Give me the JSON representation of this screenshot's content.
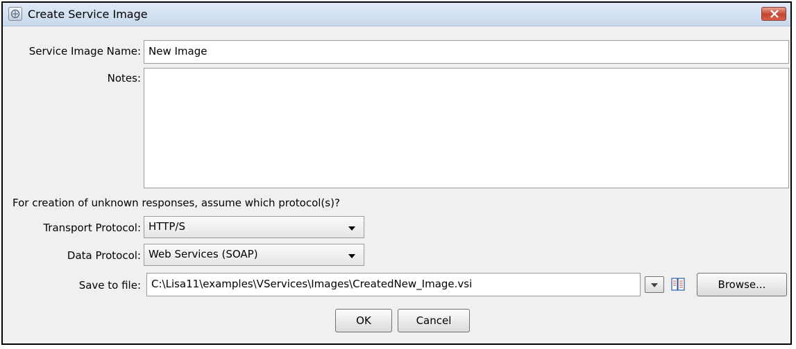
{
  "window": {
    "title": "Create Service Image"
  },
  "form": {
    "name_label": "Service Image Name:",
    "name_value": "New Image",
    "notes_label": "Notes:",
    "notes_value": "",
    "protocol_question": "For creation of unknown responses, assume which protocol(s)?",
    "transport_label": "Transport Protocol:",
    "transport_value": "HTTP/S",
    "data_label": "Data Protocol:",
    "data_value": "Web Services (SOAP)",
    "save_label": "Save to file:",
    "save_value": "C:\\Lisa11\\examples\\VServices\\Images\\CreatedNew_Image.vsi",
    "browse_label": "Browse..."
  },
  "actions": {
    "ok_label": "OK",
    "cancel_label": "Cancel"
  },
  "icons": {
    "app": "service-image-app-icon",
    "close": "close-icon",
    "dropdown": "chevron-down-icon",
    "properties": "file-properties-icon"
  },
  "colors": {
    "close_button": "#c6442d",
    "titlebar": "#d6e3f2"
  }
}
